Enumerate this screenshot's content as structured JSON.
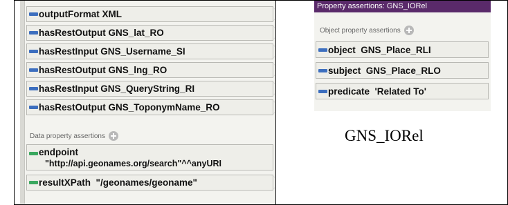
{
  "left": {
    "object_rows": [
      {
        "name": "outputFormat",
        "value": "XML"
      },
      {
        "name": "hasRestOutput",
        "value": "GNS_lat_RO"
      },
      {
        "name": "hasRestInput",
        "value": "GNS_Username_SI"
      },
      {
        "name": "hasRestOutput",
        "value": "GNS_lng_RO"
      },
      {
        "name": "hasRestInput",
        "value": "GNS_QueryString_RI"
      },
      {
        "name": "hasRestOutput",
        "value": "GNS_ToponymName_RO"
      }
    ],
    "data_section_label": "Data property assertions",
    "data_rows": [
      {
        "name": "endpoint",
        "value": "\"http://api.geonames.org/search\"^^anyURI"
      },
      {
        "name": "resultXPath",
        "value": "\"/geonames/geoname\""
      }
    ]
  },
  "right": {
    "title": "Property assertions: GNS_IORel",
    "object_section_label": "Object property assertions",
    "rows": [
      {
        "name": "object",
        "value": "GNS_Place_RLI"
      },
      {
        "name": "subject",
        "value": "GNS_Place_RLO"
      },
      {
        "name": "predicate",
        "value": "'Related To'"
      }
    ]
  },
  "caption": "GNS_IORel",
  "colors": {
    "object_property_bar": "#3d6fbf",
    "data_property_bar": "#3aa85f",
    "title_bar": "#5a2a6a"
  },
  "icons": [
    "add-icon"
  ]
}
